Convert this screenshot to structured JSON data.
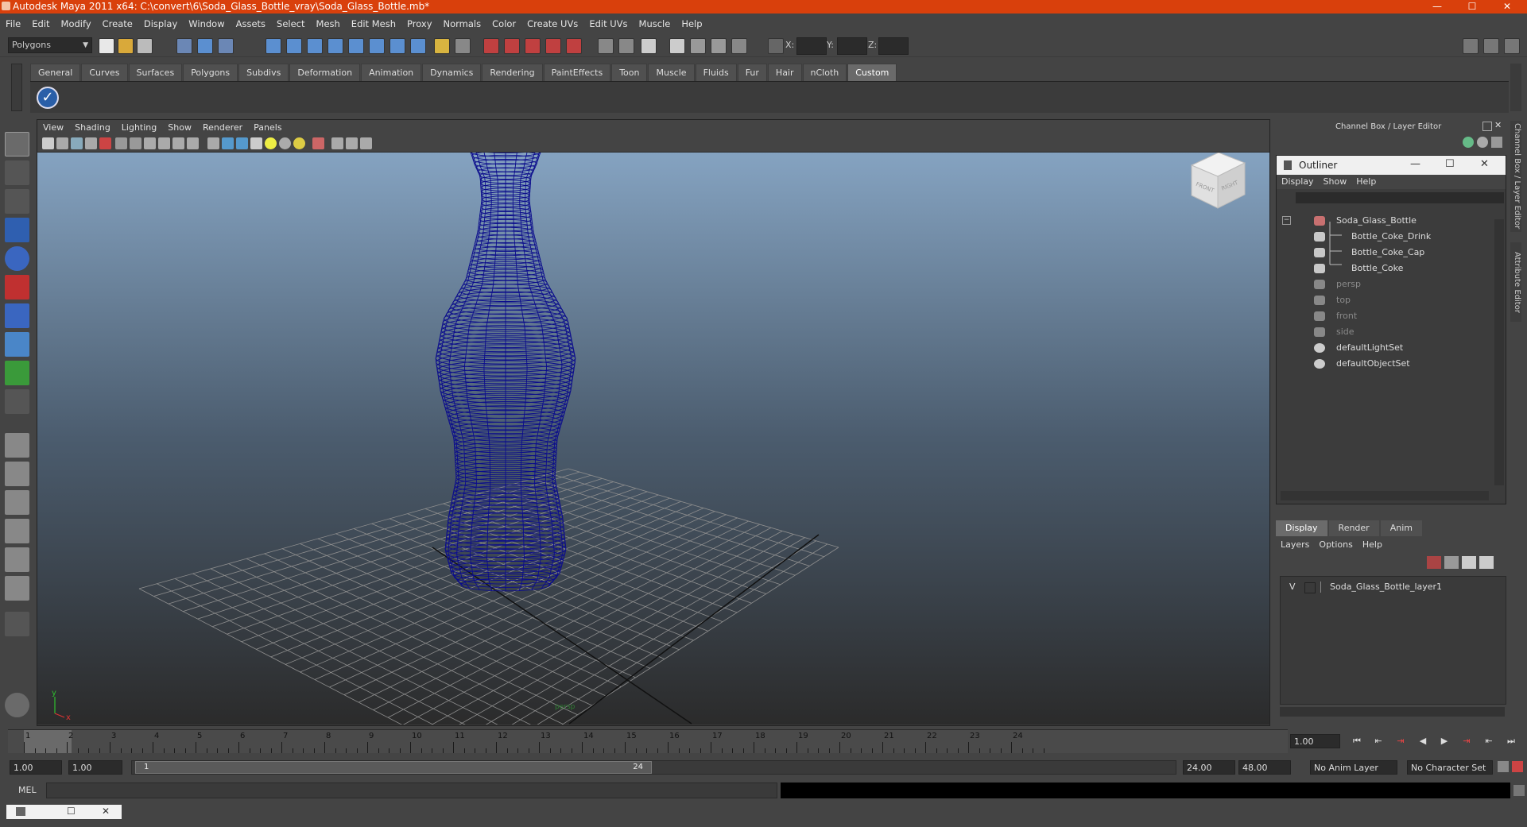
{
  "window": {
    "title": "Autodesk Maya 2011 x64: C:\\convert\\6\\Soda_Glass_Bottle_vray\\Soda_Glass_Bottle.mb*",
    "minimize": "—",
    "maximize": "☐",
    "close": "✕"
  },
  "menubar": [
    "File",
    "Edit",
    "Modify",
    "Create",
    "Display",
    "Window",
    "Assets",
    "Select",
    "Mesh",
    "Edit Mesh",
    "Proxy",
    "Normals",
    "Color",
    "Create UVs",
    "Edit UVs",
    "Muscle",
    "Help"
  ],
  "statusline": {
    "mode": "Polygons",
    "x_label": "X:",
    "y_label": "Y:",
    "z_label": "Z:"
  },
  "shelf": {
    "tabs": [
      "General",
      "Curves",
      "Surfaces",
      "Polygons",
      "Subdivs",
      "Deformation",
      "Animation",
      "Dynamics",
      "Rendering",
      "PaintEffects",
      "Toon",
      "Muscle",
      "Fluids",
      "Fur",
      "Hair",
      "nCloth",
      "Custom"
    ],
    "active_tab": "Custom"
  },
  "viewport": {
    "menu": [
      "View",
      "Shading",
      "Lighting",
      "Show",
      "Renderer",
      "Panels"
    ],
    "camera_label": "persp",
    "viewcube_front": "FRONT",
    "viewcube_right": "RIGHT",
    "axis_y": "y",
    "axis_x": "x",
    "wire_color": "#0b0c8c"
  },
  "channel_box": {
    "header": "Channel Box / Layer Editor"
  },
  "side_tabs": {
    "channel_box": "Channel Box / Layer Editor",
    "attribute_editor": "Attribute Editor"
  },
  "outliner": {
    "title": "Outliner",
    "menu": [
      "Display",
      "Show",
      "Help"
    ],
    "items": [
      {
        "label": "Soda_Glass_Bottle",
        "level": 0,
        "dim": false
      },
      {
        "label": "Bottle_Coke_Drink",
        "level": 1,
        "dim": false
      },
      {
        "label": "Bottle_Coke_Cap",
        "level": 1,
        "dim": false
      },
      {
        "label": "Bottle_Coke",
        "level": 1,
        "dim": false
      },
      {
        "label": "persp",
        "level": 0,
        "dim": true
      },
      {
        "label": "top",
        "level": 0,
        "dim": true
      },
      {
        "label": "front",
        "level": 0,
        "dim": true
      },
      {
        "label": "side",
        "level": 0,
        "dim": true
      },
      {
        "label": "defaultLightSet",
        "level": 0,
        "dim": false
      },
      {
        "label": "defaultObjectSet",
        "level": 0,
        "dim": false
      }
    ]
  },
  "layer_editor": {
    "tabs": [
      "Display",
      "Render",
      "Anim"
    ],
    "active_tab": "Display",
    "menu": [
      "Layers",
      "Options",
      "Help"
    ],
    "layers": [
      {
        "visible": "V",
        "name": "Soda_Glass_Bottle_layer1"
      }
    ]
  },
  "timeslider": {
    "ticks": [
      "1",
      "2",
      "3",
      "4",
      "5",
      "6",
      "7",
      "8",
      "9",
      "10",
      "11",
      "12",
      "13",
      "14",
      "15",
      "16",
      "17",
      "18",
      "19",
      "20",
      "21",
      "22",
      "23",
      "24"
    ],
    "current_frame": "1.00"
  },
  "range": {
    "start": "1.00",
    "playback_start": "1.00",
    "handle_start": "1",
    "handle_end": "24",
    "playback_end": "24.00",
    "end": "48.00",
    "anim_layer": "No Anim Layer",
    "character_set": "No Character Set"
  },
  "cmdline": {
    "mel_label": "MEL"
  },
  "playback": [
    "⏮",
    "⇤",
    "⇥",
    "◀",
    "▶",
    "⇥",
    "⇤",
    "⏭"
  ]
}
